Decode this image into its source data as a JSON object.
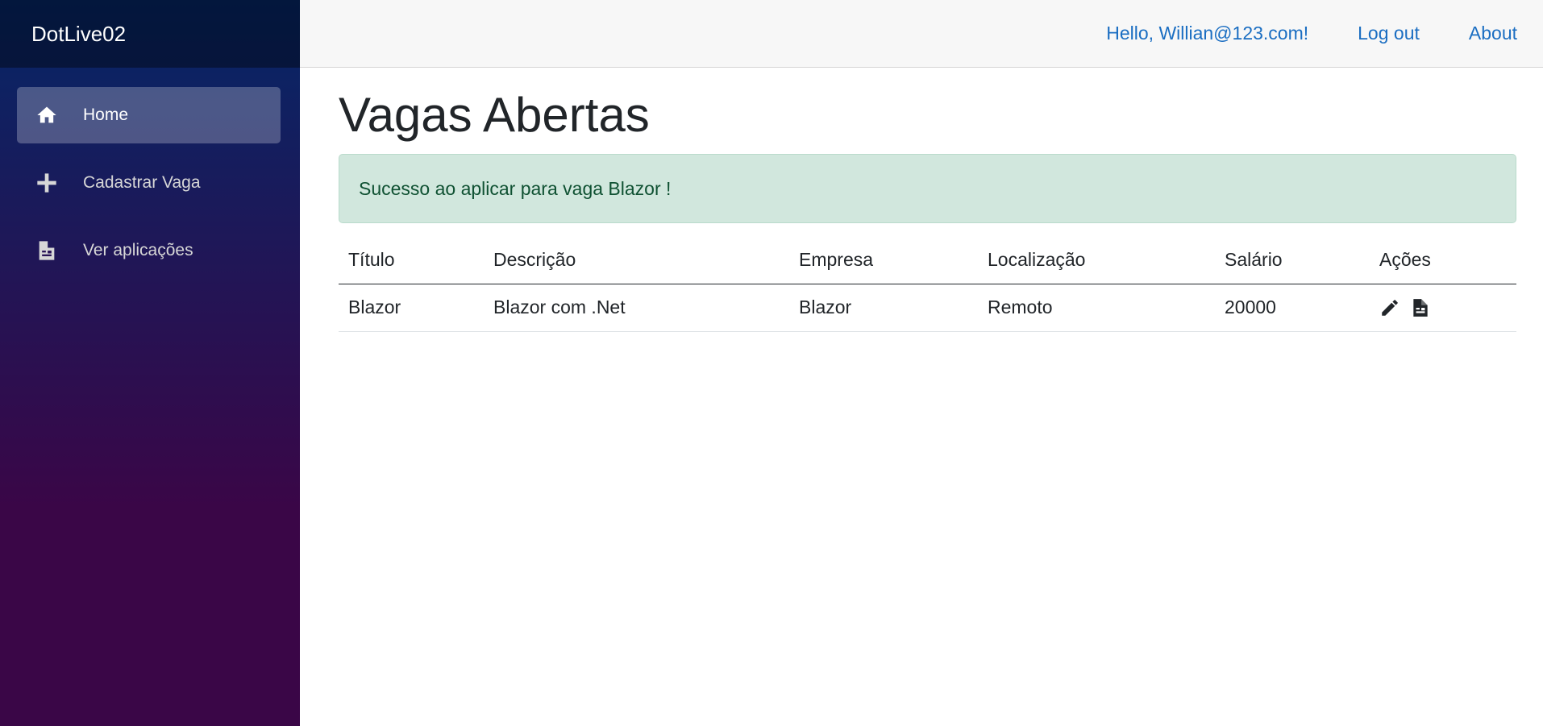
{
  "app": {
    "brand": "DotLive02"
  },
  "sidebar": {
    "items": [
      {
        "label": "Home",
        "icon": "home-icon",
        "active": true
      },
      {
        "label": "Cadastrar Vaga",
        "icon": "plus-icon",
        "active": false
      },
      {
        "label": "Ver aplicações",
        "icon": "document-icon",
        "active": false
      }
    ]
  },
  "topbar": {
    "greeting": "Hello, Willian@123.com!",
    "logout": "Log out",
    "about": "About"
  },
  "main": {
    "title": "Vagas Abertas",
    "alert": "Sucesso ao aplicar para vaga Blazor !",
    "table": {
      "headers": [
        "Título",
        "Descrição",
        "Empresa",
        "Localização",
        "Salário",
        "Ações"
      ],
      "rows": [
        {
          "titulo": "Blazor",
          "descricao": "Blazor com .Net",
          "empresa": "Blazor",
          "localizacao": "Remoto",
          "salario": "20000",
          "actions": [
            "pencil-icon",
            "apply-document-icon"
          ]
        }
      ]
    }
  },
  "colors": {
    "link": "#1b6ec2",
    "alert_bg": "#d1e7dd",
    "alert_text": "#0f5132",
    "sidebar_top": "#052767",
    "sidebar_bottom": "#3a0647"
  }
}
